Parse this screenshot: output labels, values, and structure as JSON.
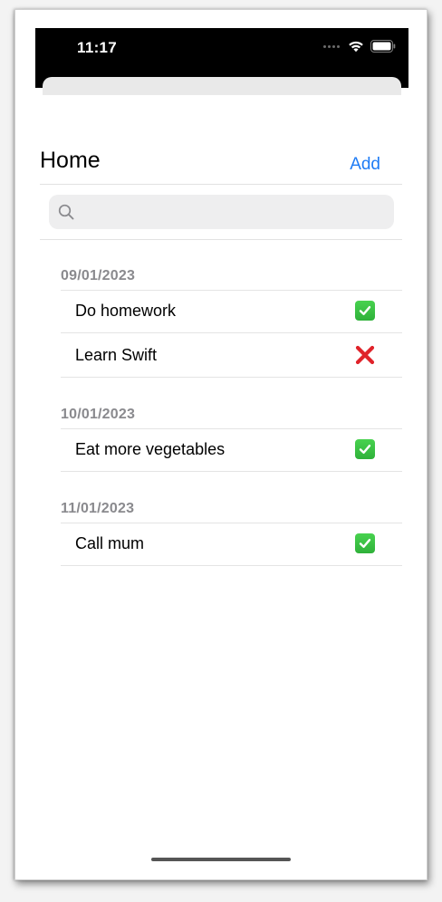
{
  "status_bar": {
    "time": "11:17"
  },
  "nav": {
    "title": "Home",
    "add_label": "Add"
  },
  "search": {
    "placeholder": "",
    "value": ""
  },
  "icons": {
    "done": "check-mark-button-icon",
    "not_done": "cross-mark-icon",
    "search": "magnifying-glass-icon"
  },
  "colors": {
    "accent": "#1f7cf5",
    "done_green": "#34c240",
    "not_done_red": "#e0232a",
    "section_header": "#8a8a8e"
  },
  "sections": [
    {
      "date": "09/01/2023",
      "items": [
        {
          "label": "Do homework",
          "done": true
        },
        {
          "label": "Learn Swift",
          "done": false
        }
      ]
    },
    {
      "date": "10/01/2023",
      "items": [
        {
          "label": "Eat more vegetables",
          "done": true
        }
      ]
    },
    {
      "date": "11/01/2023",
      "items": [
        {
          "label": "Call mum",
          "done": true
        }
      ]
    }
  ]
}
